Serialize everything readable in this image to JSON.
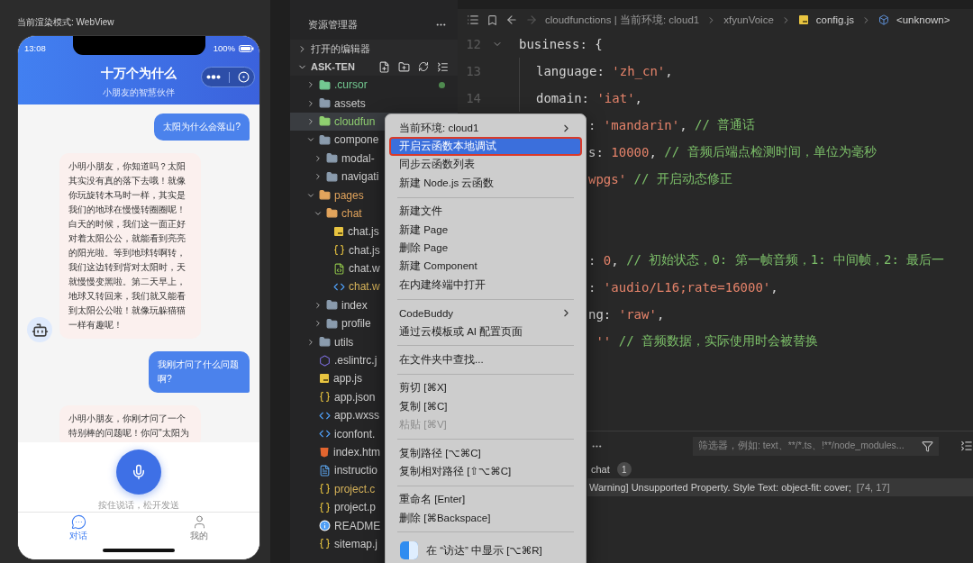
{
  "simulator": {
    "render_mode": "当前渲染模式: WebView",
    "status_bar": {
      "time": "13:08",
      "battery": "100%"
    },
    "header": {
      "title": "十万个为什么",
      "subtitle": "小朋友的智慧伙伴"
    },
    "messages": [
      {
        "kind": "user",
        "text": "太阳为什么会落山?"
      },
      {
        "kind": "bot",
        "text": "小明小朋友，你知道吗？太阳其实没有真的落下去哦！就像你玩旋转木马时一样，其实是我们的地球在慢慢转圈圈呢！白天的时候，我们这一面正好对着太阳公公，就能看到亮亮的阳光啦。等到地球转啊转，我们这边转到背对太阳时，天就慢慢变黑啦。第二天早上，地球又转回来，我们就又能看到太阳公公啦！就像玩躲猫猫一样有趣呢！"
      },
      {
        "kind": "user",
        "text": "我刚才问了什么问题啊?"
      },
      {
        "kind": "bot_cut",
        "text": "小明小朋友，你刚才问了一个特别棒的问题呢！你问\"太阳为"
      }
    ],
    "voice": {
      "hint": "按住说话，松开发送"
    },
    "tabs": [
      {
        "kind": "chat",
        "label": "对话",
        "selected": true
      },
      {
        "kind": "profile",
        "label": "我的",
        "selected": false
      }
    ]
  },
  "explorer": {
    "title": "资源管理器",
    "sections": [
      {
        "label": "打开的编辑器",
        "expanded": false
      },
      {
        "label": "ASK-TEN",
        "expanded": true
      }
    ],
    "tree": [
      {
        "label": ".cursor",
        "kind": "folder",
        "expanded": false,
        "selected": false,
        "dot": true,
        "color": "#73c991"
      },
      {
        "label": "assets",
        "kind": "folder",
        "expanded": false,
        "selected": false,
        "dot": false,
        "color": "#cccccc"
      },
      {
        "label": "cloudfun",
        "kind": "folder",
        "expanded": false,
        "selected": true,
        "dot": false,
        "color": "#8fcf70"
      },
      {
        "label": "compone",
        "kind": "folder",
        "expanded": true,
        "selected": false,
        "dot": false,
        "color": "#cccccc",
        "children": [
          {
            "label": "modal-",
            "kind": "folder",
            "expanded": false,
            "selected": false,
            "dot": false,
            "color": "#cccccc"
          },
          {
            "label": "navigati",
            "kind": "folder",
            "expanded": false,
            "selected": false,
            "dot": false,
            "color": "#cccccc"
          }
        ]
      },
      {
        "label": "pages",
        "kind": "folder",
        "expanded": true,
        "selected": false,
        "dot": false,
        "color": "#e2a45c",
        "children": [
          {
            "label": "chat",
            "kind": "folder",
            "expanded": true,
            "selected": false,
            "dot": false,
            "color": "#e2a45c",
            "children": [
              {
                "label": "chat.js",
                "kind": "js",
                "selected": false,
                "dot": false,
                "color": "#cccccc"
              },
              {
                "label": "chat.js",
                "kind": "json",
                "selected": false,
                "dot": false,
                "color": "#cccccc"
              },
              {
                "label": "chat.w",
                "kind": "wxml",
                "selected": false,
                "dot": false,
                "color": "#cccccc"
              },
              {
                "label": "chat.w",
                "kind": "wxss",
                "selected": false,
                "dot": false,
                "color": "#d8b45a"
              }
            ]
          },
          {
            "label": "index",
            "kind": "folder",
            "expanded": false,
            "selected": false,
            "dot": false,
            "color": "#cccccc"
          },
          {
            "label": "profile",
            "kind": "folder",
            "expanded": false,
            "selected": false,
            "dot": false,
            "color": "#cccccc"
          }
        ]
      },
      {
        "label": "utils",
        "kind": "folder",
        "expanded": false,
        "selected": false,
        "dot": false,
        "color": "#cccccc"
      },
      {
        "label": ".eslintrc.j",
        "kind": "eslint",
        "selected": false,
        "dot": false,
        "color": "#cccccc"
      },
      {
        "label": "app.js",
        "kind": "js",
        "selected": false,
        "dot": false,
        "color": "#cccccc"
      },
      {
        "label": "app.json",
        "kind": "json",
        "selected": false,
        "dot": false,
        "color": "#cccccc"
      },
      {
        "label": "app.wxss",
        "kind": "wxss",
        "selected": false,
        "dot": false,
        "color": "#cccccc"
      },
      {
        "label": "iconfont.",
        "kind": "wxss",
        "selected": false,
        "dot": false,
        "color": "#cccccc"
      },
      {
        "label": "index.htm",
        "kind": "html",
        "selected": false,
        "dot": false,
        "color": "#cccccc"
      },
      {
        "label": "instructio",
        "kind": "md",
        "selected": false,
        "dot": false,
        "color": "#cccccc"
      },
      {
        "label": "project.c",
        "kind": "json",
        "selected": false,
        "dot": false,
        "color": "#d8b45a"
      },
      {
        "label": "project.p",
        "kind": "json",
        "selected": false,
        "dot": false,
        "color": "#cccccc"
      },
      {
        "label": "README",
        "kind": "info",
        "selected": false,
        "dot": false,
        "color": "#cccccc"
      },
      {
        "label": "sitemap.j",
        "kind": "json",
        "selected": false,
        "dot": false,
        "color": "#cccccc"
      }
    ]
  },
  "editor": {
    "breadcrumb": [
      {
        "kind": "plain",
        "text": "cloudfunctions | 当前环境: cloud1"
      },
      {
        "kind": "plain",
        "text": "xfyunVoice"
      },
      {
        "kind": "js",
        "text": "config.js"
      },
      {
        "kind": "symbol",
        "text": "<unknown>"
      }
    ],
    "lines": [
      {
        "kind": "open",
        "number": "12",
        "fold": true,
        "tokens": [
          {
            "kind": "plain",
            "t": "business: {"
          }
        ]
      },
      {
        "kind": "member",
        "number": "13",
        "fold": false,
        "tokens": [
          {
            "kind": "plain",
            "t": "language: "
          },
          {
            "kind": "string",
            "t": "'zh_cn'"
          },
          {
            "kind": "plain",
            "t": ","
          }
        ]
      },
      {
        "kind": "member",
        "number": "14",
        "fold": false,
        "tokens": [
          {
            "kind": "plain",
            "t": "domain: "
          },
          {
            "kind": "string",
            "t": "'iat'"
          },
          {
            "kind": "plain",
            "t": ","
          }
        ]
      },
      {
        "kind": "clipped",
        "tokens": [
          {
            "kind": "plain",
            "t": ": "
          },
          {
            "kind": "string",
            "t": "'mandarin'"
          },
          {
            "kind": "plain",
            "t": ", "
          },
          {
            "kind": "comment",
            "t": "// 普通话"
          }
        ]
      },
      {
        "kind": "clipped",
        "tokens": [
          {
            "kind": "plain",
            "t": "s: "
          },
          {
            "kind": "number",
            "t": "10000"
          },
          {
            "kind": "plain",
            "t": ", "
          },
          {
            "kind": "comment",
            "t": "// 音频后端点检测时间，单位为毫秒"
          }
        ]
      },
      {
        "kind": "clipped",
        "tokens": [
          {
            "kind": "string",
            "t": "wpgs'"
          },
          {
            "kind": "comment",
            "t": " // 开启动态修正"
          }
        ]
      },
      {
        "kind": "blank"
      },
      {
        "kind": "blank"
      },
      {
        "kind": "clipped",
        "tokens": [
          {
            "kind": "plain",
            "t": ": "
          },
          {
            "kind": "number",
            "t": "0"
          },
          {
            "kind": "plain",
            "t": ", "
          },
          {
            "kind": "comment",
            "t": "// 初始状态，0: 第一帧音频，1: 中间帧，2: 最后一"
          }
        ]
      },
      {
        "kind": "clipped",
        "tokens": [
          {
            "kind": "plain",
            "t": ": "
          },
          {
            "kind": "string",
            "t": "'audio/L16;rate=16000'"
          },
          {
            "kind": "plain",
            "t": ","
          }
        ]
      },
      {
        "kind": "clipped",
        "tokens": [
          {
            "kind": "plain",
            "t": "ng: "
          },
          {
            "kind": "string",
            "t": "'raw'"
          },
          {
            "kind": "plain",
            "t": ","
          }
        ]
      },
      {
        "kind": "clipped",
        "tokens": [
          {
            "kind": "string",
            "t": " ''"
          },
          {
            "kind": "comment",
            "t": " // 音频数据，实际使用时会被替换"
          }
        ]
      }
    ],
    "panel": {
      "filter_placeholder": "筛选器，例如: text、**/*.ts、!**/node_modules...",
      "source": "chat",
      "count": "1",
      "message": "Warning] Unsupported Property. Style Text: object-fit: cover;",
      "position": "[74, 17]"
    }
  },
  "context_menu": {
    "groups": [
      [
        {
          "kind": "submenu",
          "label": "当前环境: cloud1",
          "selected": false,
          "outlined": false
        },
        {
          "kind": "plain",
          "label": "开启云函数本地调试",
          "selected": true,
          "outlined": true
        },
        {
          "kind": "plain",
          "label": "同步云函数列表",
          "selected": false,
          "outlined": false
        },
        {
          "kind": "plain",
          "label": "新建 Node.js 云函数",
          "selected": false,
          "outlined": false
        }
      ],
      [
        {
          "kind": "plain",
          "label": "新建文件",
          "selected": false,
          "outlined": false
        },
        {
          "kind": "plain",
          "label": "新建 Page",
          "selected": false,
          "outlined": false
        },
        {
          "kind": "plain",
          "label": "删除 Page",
          "selected": false,
          "outlined": false
        },
        {
          "kind": "plain",
          "label": "新建 Component",
          "selected": false,
          "outlined": false
        },
        {
          "kind": "plain",
          "label": "在内建终端中打开",
          "selected": false,
          "outlined": false
        }
      ],
      [
        {
          "kind": "submenu",
          "label": "CodeBuddy",
          "selected": false,
          "outlined": false
        },
        {
          "kind": "plain",
          "label": "通过云模板或 AI 配置页面",
          "selected": false,
          "outlined": false
        }
      ],
      [
        {
          "kind": "plain",
          "label": "在文件夹中查找...",
          "selected": false,
          "outlined": false
        }
      ],
      [
        {
          "kind": "plain",
          "label": "剪切 [⌘X]",
          "selected": false,
          "outlined": false
        },
        {
          "kind": "plain",
          "label": "复制 [⌘C]",
          "selected": false,
          "outlined": false
        },
        {
          "kind": "disabled",
          "label": "粘贴 [⌘V]",
          "selected": false,
          "outlined": false
        }
      ],
      [
        {
          "kind": "plain",
          "label": "复制路径 [⌥⌘C]",
          "selected": false,
          "outlined": false
        },
        {
          "kind": "plain",
          "label": "复制相对路径 [⇧⌥⌘C]",
          "selected": false,
          "outlined": false
        }
      ],
      [
        {
          "kind": "plain",
          "label": "重命名 [Enter]",
          "selected": false,
          "outlined": false
        },
        {
          "kind": "plain",
          "label": "删除 [⌘Backspace]",
          "selected": false,
          "outlined": false
        }
      ],
      [
        {
          "kind": "finder",
          "label": "在 “访达” 中显示 [⌥⌘R]",
          "selected": false,
          "outlined": false
        }
      ]
    ]
  }
}
